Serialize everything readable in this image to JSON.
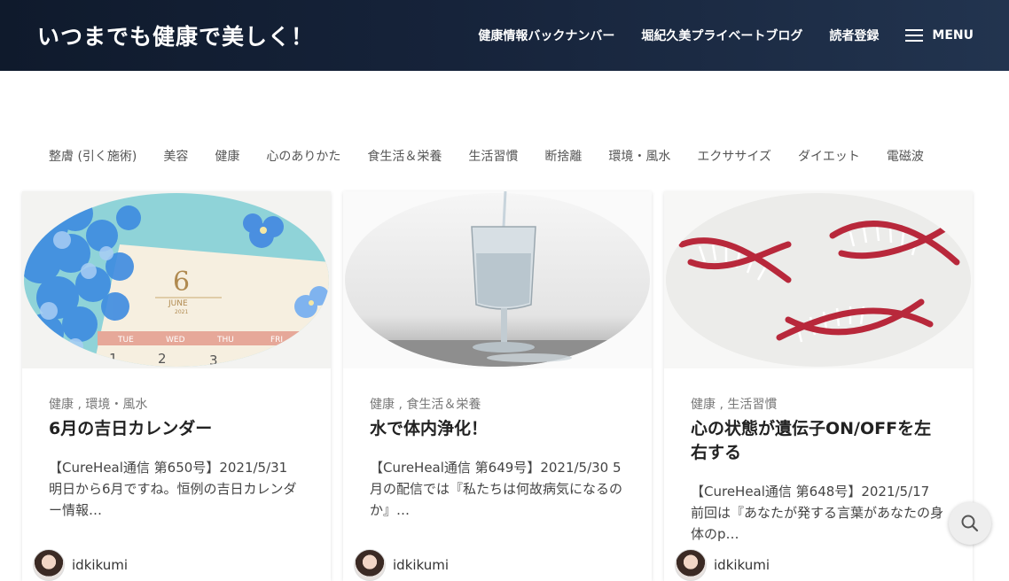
{
  "header": {
    "site_title": "いつまでも健康で美しく！",
    "nav": [
      "健康情報バックナンバー",
      "堀紀久美プライベートブログ",
      "読者登録"
    ],
    "menu_label": "MENU"
  },
  "categories": [
    "整膚 (引く施術)",
    "美容",
    "健康",
    "心のありかた",
    "食生活＆栄養",
    "生活習慣",
    "断捨離",
    "環境・風水",
    "エクササイズ",
    "ダイエット",
    "電磁波"
  ],
  "posts": [
    {
      "image": "calendar-hydrangea-image",
      "categories": "健康 , 環境・風水",
      "title": "6月の吉日カレンダー",
      "excerpt": "【CureHeal通信 第650号】2021/5/31 明日から6月ですね。恒例の吉日カレンダー情報…",
      "author": "idkikumi",
      "calendar": {
        "month_num": "6",
        "month_name": "JUNE",
        "year": "2021",
        "days": [
          "TUE",
          "WED",
          "THU",
          "FRI"
        ],
        "dates": [
          "1",
          "2",
          "3"
        ]
      }
    },
    {
      "image": "water-glass-image",
      "categories": "健康 , 食生活＆栄養",
      "title": "水で体内浄化！",
      "excerpt": "【CureHeal通信 第649号】2021/5/30 5月の配信では『私たちは何故病気になるのか』…",
      "author": "idkikumi"
    },
    {
      "image": "dna-helix-image",
      "categories": "健康 , 生活習慣",
      "title": "心の状態が遺伝子ON/OFFを左右する",
      "excerpt": "【CureHeal通信 第648号】2021/5/17 前回は『あなたが発する言葉があなたの身体のp…",
      "author": "idkikumi"
    }
  ],
  "search_icon": "search-icon",
  "colors": {
    "header_bg": "#16233a",
    "dna_red": "#b8283b"
  }
}
